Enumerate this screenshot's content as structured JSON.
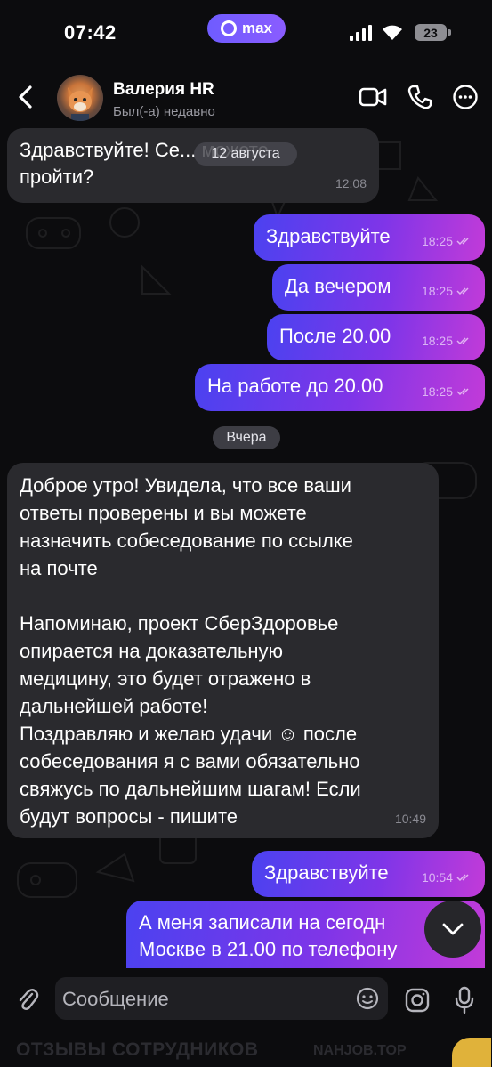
{
  "status_bar": {
    "time": "07:42",
    "app_badge": "max",
    "battery": "23"
  },
  "header": {
    "contact_name": "Валерия HR",
    "contact_status": "Был(-а) недавно"
  },
  "dates": {
    "top": "12 августа",
    "yesterday": "Вчера"
  },
  "messages": [
    {
      "dir": "in",
      "text": "Здравствуйте! Се... можете\nпройти?",
      "time": "12:08"
    },
    {
      "dir": "out",
      "text": "Здравствуйте",
      "time": "18:25"
    },
    {
      "dir": "out",
      "text": "Да вечером",
      "time": "18:25"
    },
    {
      "dir": "out",
      "text": "После 20.00",
      "time": "18:25"
    },
    {
      "dir": "out",
      "text": "На работе до 20.00",
      "time": "18:25"
    },
    {
      "dir": "in",
      "text": "Доброе утро! Увидела, что все ваши\nответы проверены и вы можете\nназначить собеседование по ссылке\nна почте\n\nНапоминаю, проект СберЗдоровье\nопирается на доказательную\nмедицину, это будет отражено в\nдальнейшей работе!\nПоздравляю и желаю удачи ☺  после\nсобеседования я с вами обязательно\nсвяжусь по дальнейшим шагам! Если\nбудут вопросы - пишите",
      "time": "10:49"
    },
    {
      "dir": "out",
      "text": "Здравствуйте",
      "time": "10:54"
    },
    {
      "dir": "out",
      "text": "А меня записали на сегодн\nМоскве в 21.00 по телефону",
      "time": ""
    }
  ],
  "input": {
    "placeholder": "Сообщение"
  },
  "watermark": {
    "left": "ОТЗЫВЫ СОТРУДНИКОВ",
    "right": "NAHJOB.TOP"
  },
  "colors": {
    "outgoing_start": "#4b42f0",
    "outgoing_end": "#c23bd8",
    "incoming": "#2a2a2e",
    "accent": "#7b5cff"
  }
}
